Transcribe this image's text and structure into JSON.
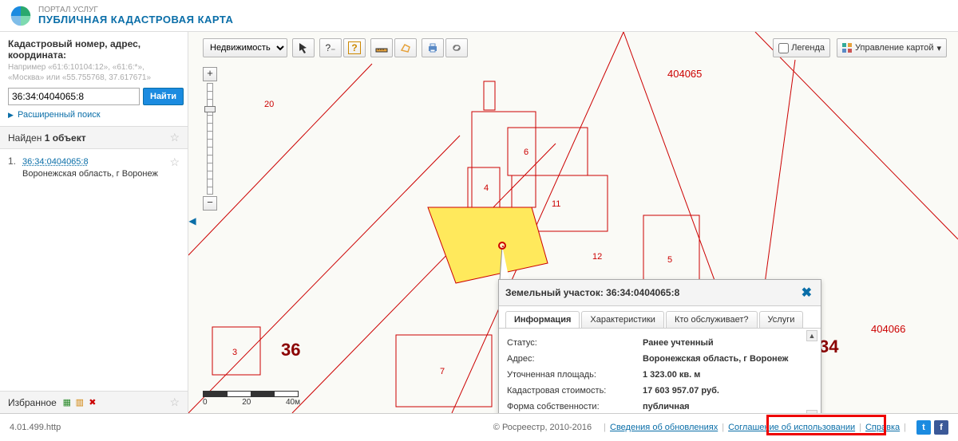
{
  "header": {
    "suptitle": "ПОРТАЛ УСЛУГ",
    "title": "ПУБЛИЧНАЯ КАДАСТРОВАЯ КАРТА"
  },
  "search": {
    "label": "Кадастровый номер, адрес, координата:",
    "hint": "Например «61:6:10104:12», «61:6:*», «Москва» или «55.755768, 37.617671»",
    "value": "36:34:0404065:8",
    "button": "Найти",
    "advanced": "Расширенный поиск"
  },
  "results": {
    "found_prefix": "Найден ",
    "found_count": "1 объект",
    "items": [
      {
        "num": "1.",
        "id": "36:34:0404065:8",
        "addr": "Воронежская область, г Воронеж"
      }
    ]
  },
  "favorites": {
    "label": "Избранное"
  },
  "toolbar": {
    "layer_select": "Недвижимость",
    "legend": "Легенда",
    "layers": "Управление картой"
  },
  "scale": {
    "l": "0",
    "m": "20",
    "r": "40м"
  },
  "popup": {
    "title": "Земельный участок: 36:34:0404065:8",
    "tabs": [
      "Информация",
      "Характеристики",
      "Кто обслуживает?",
      "Услуги"
    ],
    "rows": [
      {
        "k": "Статус:",
        "v": "Ранее учтенный"
      },
      {
        "k": "Адрес:",
        "v": "Воронежская область, г Воронеж"
      },
      {
        "k": "Уточненная площадь:",
        "v": "1 323.00 кв. м"
      },
      {
        "k": "Кадастровая стоимость:",
        "v": "17 603 957.07 руб."
      },
      {
        "k": "Форма собственности:",
        "v": "публичная"
      }
    ]
  },
  "footer": {
    "version": "4.01.499.http",
    "copyright": "© Росреестр, 2010-2016",
    "links": [
      "Сведения об обновлениях",
      "Соглашение об использовании",
      "Справка"
    ]
  },
  "maplabels": {
    "p20": "20",
    "p4": "4",
    "p6": "6",
    "p11": "11",
    "p3": "3",
    "p7": "7",
    "p12": "12",
    "p5": "5",
    "big36": "36",
    "big34": "34",
    "block1": "404065",
    "block2": "404066"
  }
}
